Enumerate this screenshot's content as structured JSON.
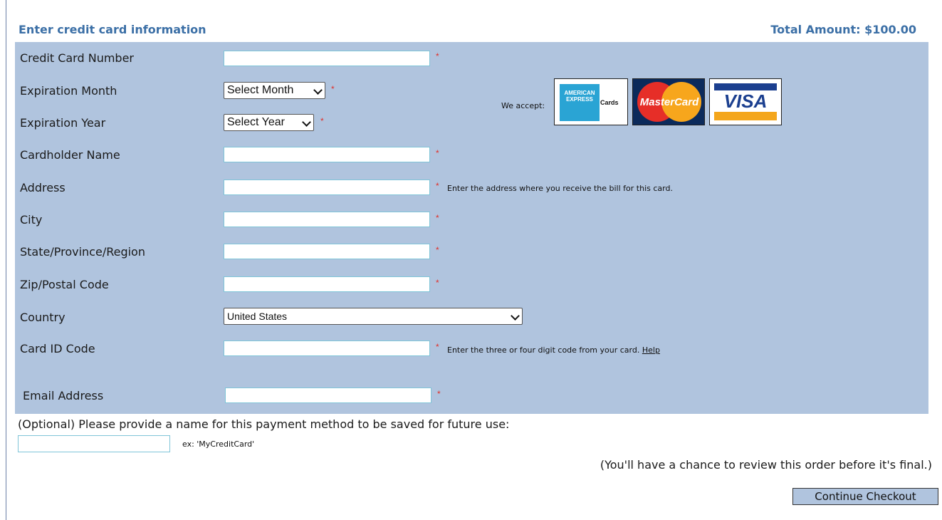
{
  "header": {
    "title": "Enter credit card information",
    "total": "Total Amount: $100.00"
  },
  "form": {
    "credit_card_number": {
      "label": "Credit Card Number",
      "value": ""
    },
    "expiration_month": {
      "label": "Expiration Month",
      "selected": "Select Month"
    },
    "expiration_year": {
      "label": "Expiration Year",
      "selected": "Select Year"
    },
    "cardholder_name": {
      "label": "Cardholder Name",
      "value": ""
    },
    "address": {
      "label": "Address",
      "value": "",
      "hint": "Enter the address where you receive the bill for this card."
    },
    "city": {
      "label": "City",
      "value": ""
    },
    "state": {
      "label": "State/Province/Region",
      "value": ""
    },
    "zip": {
      "label": "Zip/Postal Code",
      "value": ""
    },
    "country": {
      "label": "Country",
      "selected": "United States"
    },
    "card_id": {
      "label": "Card ID Code",
      "value": "",
      "hint": "Enter the three or four digit code from your card.",
      "help_link": "Help"
    },
    "email": {
      "label": "Email Address",
      "value": ""
    },
    "required_marker": "*"
  },
  "accept": {
    "label": "We accept:",
    "cards": [
      {
        "name": "American Express",
        "lines": [
          "AMERICAN",
          "EXPRESS"
        ],
        "suffix": "Cards"
      },
      {
        "name": "MasterCard",
        "text": "MasterCard"
      },
      {
        "name": "Visa",
        "text": "VISA"
      }
    ]
  },
  "optional": {
    "label": "(Optional) Please provide a name for this payment method to be saved for future use:",
    "value": "",
    "example": "ex: 'MyCreditCard'"
  },
  "review_note": "(You'll have a chance to review this order before it's final.)",
  "continue_label": "Continue Checkout",
  "colors": {
    "panel_bg": "#b0c4de",
    "header_text": "#3b6fa6",
    "required": "#e0302a",
    "field_border": "#7fc5d8"
  }
}
